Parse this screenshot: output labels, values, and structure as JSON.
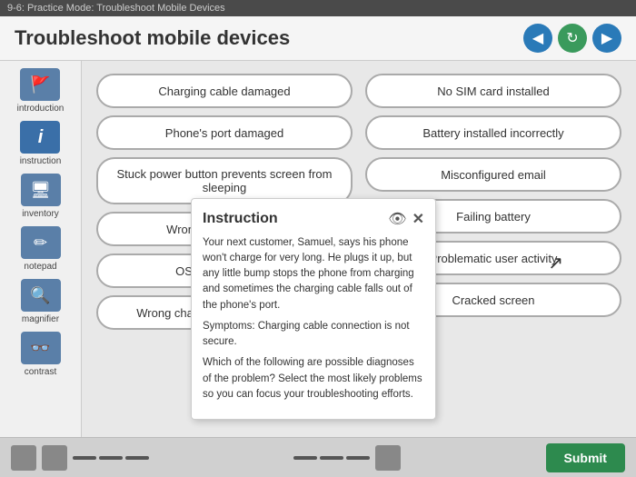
{
  "topbar": {
    "title": "9-6: Practice Mode: Troubleshoot Mobile Devices"
  },
  "header": {
    "title": "Troubleshoot mobile devices",
    "nav": {
      "back_label": "◀",
      "refresh_label": "↻",
      "forward_label": "▶"
    }
  },
  "sidebar": {
    "items": [
      {
        "id": "introduction",
        "label": "introduction",
        "icon": "🚩"
      },
      {
        "id": "instruction",
        "label": "instruction",
        "icon": "ℹ"
      },
      {
        "id": "inventory",
        "label": "inventory",
        "icon": "🖥"
      },
      {
        "id": "notepad",
        "label": "notepad",
        "icon": "✏"
      },
      {
        "id": "magnifier",
        "label": "magnifier",
        "icon": "🔍"
      },
      {
        "id": "contrast",
        "label": "contrast",
        "icon": "👓"
      }
    ]
  },
  "left_column": {
    "items": [
      {
        "id": "charging-cable-damaged",
        "label": "Charging cable damaged"
      },
      {
        "id": "phones-port-damaged",
        "label": "Phone's port damaged"
      },
      {
        "id": "stuck-power-button",
        "label": "Stuck power button prevents screen from sleeping"
      },
      {
        "id": "wrong-case",
        "label": "Wrong case for phone"
      },
      {
        "id": "os-needs-updates",
        "label": "OS needs updates"
      },
      {
        "id": "wrong-charging-cable",
        "label": "Wrong charging cable being used"
      }
    ]
  },
  "right_column": {
    "items": [
      {
        "id": "no-sim",
        "label": "No SIM card installed"
      },
      {
        "id": "battery-incorrectly",
        "label": "Battery installed incorrectly"
      },
      {
        "id": "misconfigured-email",
        "label": "Misconfigured email"
      },
      {
        "id": "failing-battery",
        "label": "Failing battery"
      },
      {
        "id": "problematic-user",
        "label": "Problematic user activity"
      },
      {
        "id": "cracked-screen",
        "label": "Cracked screen"
      }
    ]
  },
  "popup": {
    "title": "Instruction",
    "body1": "Your next customer, Samuel, says his phone won't charge for very long. He plugs it up, but any little bump stops the phone from charging and sometimes the charging cable falls out of the phone's port.",
    "body2": "Symptoms: Charging cable connection is not secure.",
    "body3": "Which of the following are possible diagnoses of the problem? Select the most likely problems so you can focus your troubleshooting efforts."
  },
  "bottom": {
    "submit_label": "Submit"
  }
}
